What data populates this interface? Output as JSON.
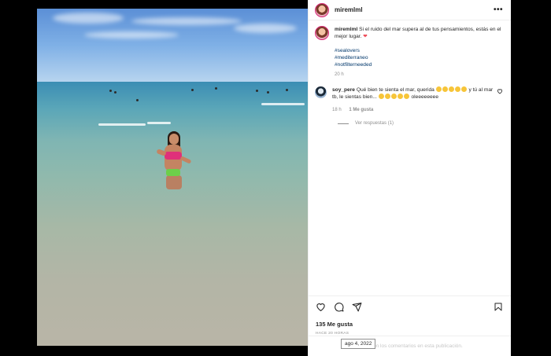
{
  "post": {
    "username": "miremlml",
    "caption": "Si el ruido del mar supera al de tus pensamientos, estás en el mejor lugar.",
    "caption_emoji": "❤",
    "hashtags": [
      "#sealovers",
      "#mediterraneo",
      "#notfilterneeded"
    ],
    "caption_time": "20 h",
    "likes": "135 Me gusta",
    "time_ago": "HACE 20 HORAS",
    "date_tooltip": "ago 4, 2022",
    "comments_disabled": "on los comentarios en esta publicación.",
    "more_icon": "•••"
  },
  "comments": [
    {
      "username": "soy_pere",
      "text_before": "Qué bien te sienta el mar, querida",
      "text_middle": "y tú al mar tb, le sientas bien...",
      "text_after": "oleeeeeeee",
      "time": "18 h",
      "likes_label": "1 Me gusta",
      "replies_label": "Ver respuestas (1)"
    }
  ],
  "icons": {
    "like": "heart-icon",
    "comment": "comment-icon",
    "share": "send-icon",
    "save": "bookmark-icon"
  },
  "colors": {
    "accent_red": "#ed4956",
    "hashtag": "#00376b",
    "muted": "#8e8e8e"
  }
}
